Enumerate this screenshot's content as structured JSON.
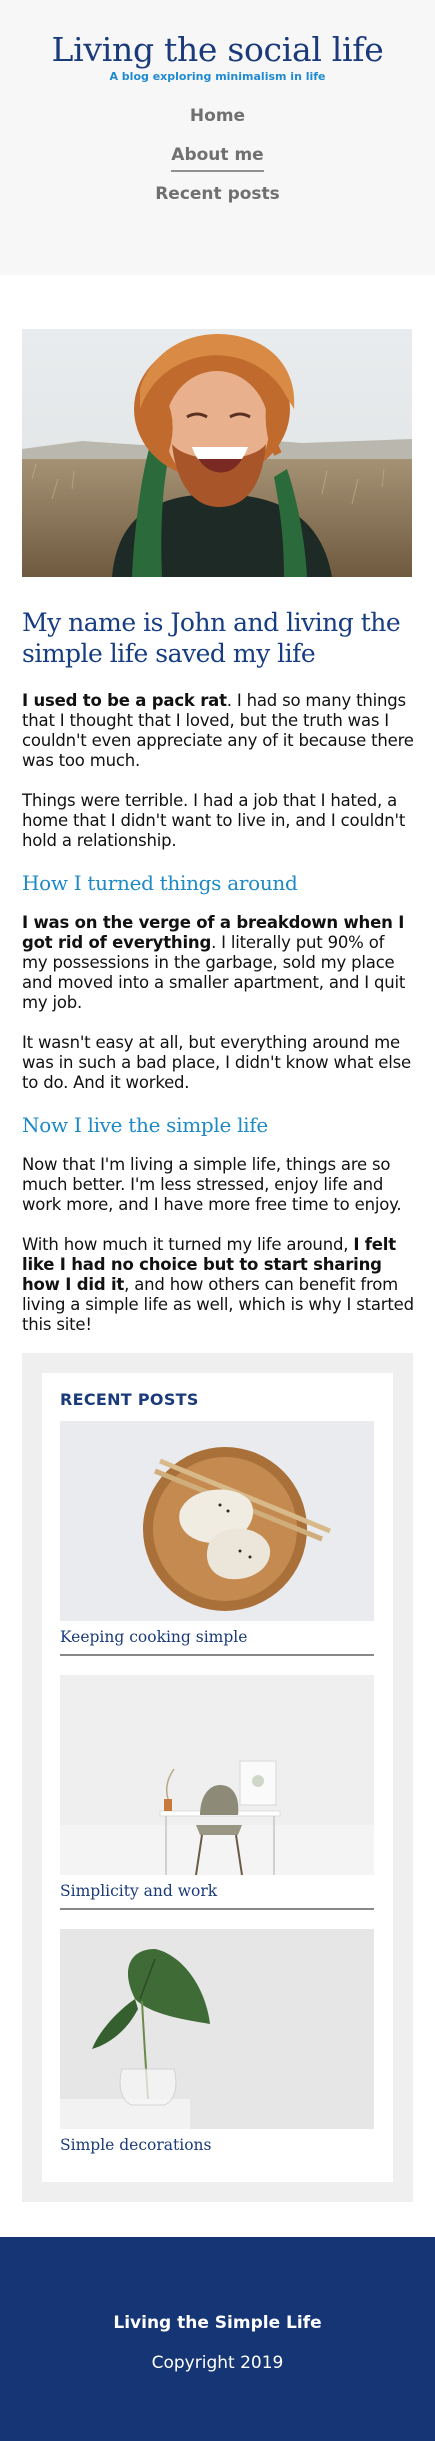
{
  "site": {
    "title": "Living the social life",
    "tagline": "A blog exploring minimalism in life"
  },
  "nav": {
    "items": [
      {
        "label": "Home"
      },
      {
        "label": "About me"
      },
      {
        "label": "Recent posts"
      }
    ],
    "active": "About me"
  },
  "hero": {
    "image": "smiling-hiker-photo"
  },
  "article": {
    "title": "My name is John and living the simple life saved my life",
    "p1_bold": "I used to be a pack rat",
    "p1_rest": ". I had so many things that I thought that I loved, but the truth was I couldn't even appreciate any of it because there was too much.",
    "p2": "Things were terrible. I had a job that I hated, a home that I didn't want to live in, and I couldn't hold a relationship.",
    "h2_1": "How I turned things around",
    "p3_bold": "I was on the verge of a breakdown when I got rid of everything",
    "p3_rest": ". I literally put 90% of my possessions in the garbage, sold my place and moved into a smaller apartment, and I quit my job.",
    "p4": "It wasn't easy at all, but everything around me was in such a bad place, I didn't know what else to do. And it worked.",
    "h2_2": "Now I live the simple life",
    "p5": "Now that I'm living a simple life, things are so much better. I'm less stressed, enjoy life and work more, and I have more free time to enjoy.",
    "p6_start": "With how much it turned my life around, ",
    "p6_bold": "I felt like I had no choice but to start sharing how I did it",
    "p6_rest": ", and how others can benefit from living a simple life as well, which is why I started this site!"
  },
  "sidebar": {
    "heading": "RECENT POSTS",
    "posts": [
      {
        "title": "Keeping cooking simple",
        "image": "dumplings-bowl-photo"
      },
      {
        "title": "Simplicity and work",
        "image": "desk-chair-photo"
      },
      {
        "title": "Simple decorations",
        "image": "plant-vase-photo"
      }
    ]
  },
  "footer": {
    "title": "Living the Simple Life",
    "copyright": "Copyright 2019"
  },
  "colors": {
    "title_blue": "#1a3a7a",
    "accent_blue": "#1f8ad1",
    "footer_bg": "#163574",
    "header_bg": "#f7f7f7"
  }
}
